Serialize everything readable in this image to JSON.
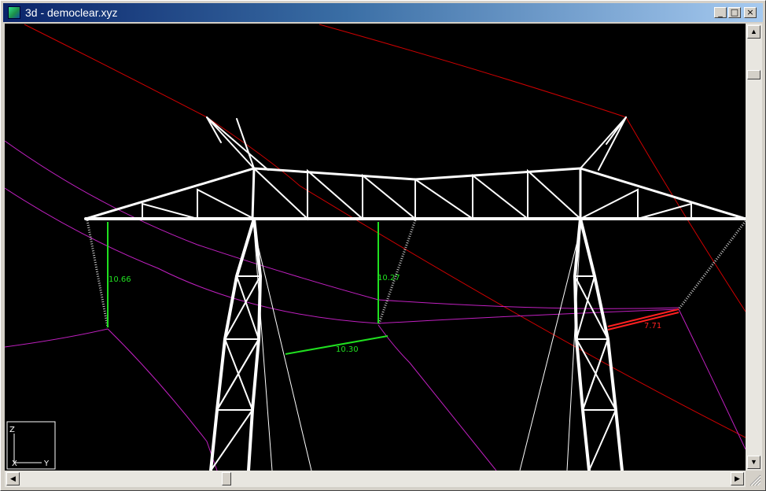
{
  "window": {
    "title": "3d - democlear.xyz",
    "minimize_glyph": "_",
    "maximize_glyph": "□",
    "close_glyph": "×"
  },
  "scene": {
    "clearance_labels": [
      "10.66",
      "10.27",
      "10.30",
      "7.71"
    ],
    "colors": {
      "tower": "#ffffff",
      "conductor_top": "#d00000",
      "conductor_phase": "#c020c0",
      "clearance_ok": "#20e020",
      "clearance_violation": "#ff2020",
      "insulator": "#c0c0c0"
    }
  },
  "axis_triad": {
    "z_label": "Z",
    "x_label": "X",
    "y_label": "Y"
  },
  "scrollbars": {
    "up_arrow": "▲",
    "down_arrow": "▼",
    "left_arrow": "◀",
    "right_arrow": "▶"
  }
}
